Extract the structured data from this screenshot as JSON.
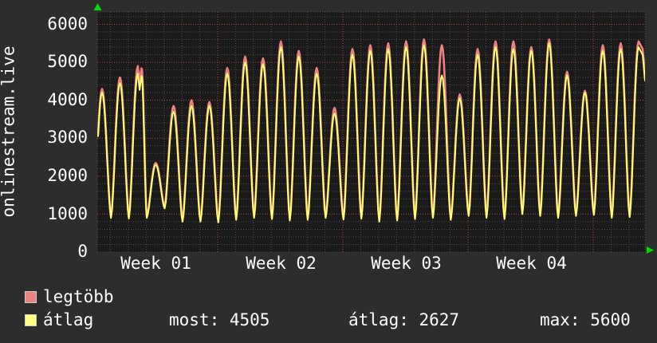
{
  "app": {
    "type": "monitoring-graph"
  },
  "colors": {
    "outer_bg": "#2d2d2d",
    "plot_bg": "#1a1a1a",
    "text": "#ffffff",
    "grid_minor": "#4d4d4d",
    "grid_major": "#aa4747",
    "series_max": "#f08080",
    "series_avg": "#ffff70",
    "legend_max_fill": "#ef8080",
    "legend_avg_fill": "#ffff80",
    "arrow": "#00dd00"
  },
  "y_axis_title": "onlinestream.live",
  "legend": {
    "items": [
      {
        "label": "legtöbb",
        "color": "#ef8080"
      },
      {
        "label": "átlag",
        "color": "#ffff80"
      }
    ],
    "stats": [
      {
        "label": "most",
        "value": 4505,
        "text": "most: 4505"
      },
      {
        "label": "átlag",
        "value": 2627,
        "text": "átlag: 2627"
      },
      {
        "label": "max",
        "value": 5600,
        "text": "max: 5600"
      }
    ]
  },
  "chart_data": {
    "type": "line",
    "title": "onlinestream.live",
    "x_tick_labels": [
      "Week 01",
      "Week 02",
      "Week 03",
      "Week 04"
    ],
    "y_ticks": [
      {
        "v": 6000,
        "label": "6000"
      },
      {
        "v": 5000,
        "label": "5000"
      },
      {
        "v": 4000,
        "label": "4000"
      },
      {
        "v": 3000,
        "label": "3000"
      },
      {
        "v": 2000,
        "label": "2000"
      },
      {
        "v": 1000,
        "label": "1000"
      },
      {
        "v": 0,
        "label": "0"
      }
    ],
    "y_axis": {
      "min": 0,
      "max_visible": 6350,
      "major_grid": 1000,
      "minor_grid": 200
    },
    "x_axis": {
      "unit": "day",
      "span_days": 31,
      "major_grid": "1 week",
      "minor_grid": "1 day"
    },
    "grid": true,
    "legend_position": "bottom-left",
    "series": [
      {
        "name": "legtöbb",
        "meaning": "daily maximum",
        "color": "#f08080",
        "daily_peaks": [
          4300,
          4600,
          4900,
          2350,
          3850,
          4000,
          3950,
          4850,
          5150,
          5100,
          5550,
          5300,
          4850,
          3800,
          5350,
          5450,
          5500,
          5550,
          5600,
          5450,
          4150,
          5350,
          5550,
          5550,
          5400,
          5600,
          4750,
          4250,
          5450,
          5500,
          5550
        ],
        "end_value": 4680
      },
      {
        "name": "átlag",
        "meaning": "daily average",
        "color": "#ffff70",
        "daily_peaks": [
          4200,
          4450,
          4700,
          2300,
          3700,
          3850,
          3850,
          4700,
          5000,
          4950,
          5400,
          5150,
          4700,
          3650,
          5200,
          5300,
          5350,
          5400,
          5450,
          4650,
          4050,
          5200,
          5400,
          5350,
          5300,
          5500,
          4650,
          4200,
          5300,
          5350,
          5400
        ],
        "end_value": 4505
      }
    ],
    "daily_troughs": [
      850,
      900,
      880,
      900,
      1150,
      800,
      800,
      780,
      850,
      900,
      870,
      830,
      850,
      900,
      860,
      880,
      800,
      830,
      870,
      900,
      850,
      950,
      900,
      870,
      1000,
      950,
      900,
      950,
      980,
      900,
      920
    ],
    "notch_day_index": 2,
    "stats": {
      "most": 4505,
      "átlag": 2627,
      "max": 5600
    }
  }
}
